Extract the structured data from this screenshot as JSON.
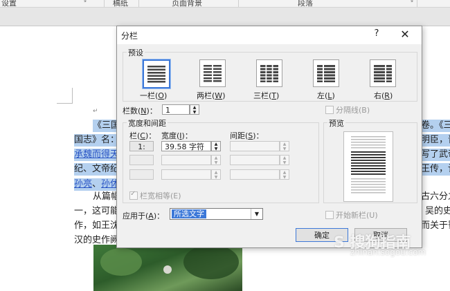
{
  "ribbon": {
    "group_left": "设置",
    "group_manuscript": "稿纸",
    "group_page_bg": "页面背景",
    "group_paragraph": "段落",
    "expander": "↘"
  },
  "document": {
    "para1_line1_left": "《三国",
    "para1_line1_right": "卷。《三",
    "line2_left": "国志》名：",
    "line2_right": "明臣，晋",
    "line3_left": "承魏而得天",
    "line3_right": "写了武帝",
    "line4_left": "纪、文帝纪",
    "line4_right": "王传，记",
    "line5_left_a": "孙亮",
    "line5_sep": "、",
    "line5_left_b": "孙休",
    "line6_left": "从篇幅",
    "line6_right": "古六分之",
    "line7_left": "一，这可能",
    "line7_right": "吴的史",
    "line8_left": "作，如王沈",
    "line8_right": "而关于蜀",
    "line9_left": "汉的史作阙",
    "para_mark": "↵"
  },
  "dialog": {
    "title": "分栏",
    "help": "?",
    "close": "✕",
    "presets_label": "预设",
    "presets": [
      {
        "label": "一栏",
        "key": "O",
        "icon": "one-column-icon"
      },
      {
        "label": "两栏",
        "key": "W",
        "icon": "two-columns-icon"
      },
      {
        "label": "三栏",
        "key": "T",
        "icon": "three-columns-icon"
      },
      {
        "label": "左",
        "key": "L",
        "icon": "left-column-icon"
      },
      {
        "label": "右",
        "key": "R",
        "icon": "right-column-icon"
      }
    ],
    "num_columns_label": "栏数",
    "num_columns_key": "N",
    "num_columns_value": "1",
    "separator_label": "分隔线(B)",
    "width_spacing_label": "宽度和间距",
    "col_label": "栏",
    "col_key": "C",
    "width_label": "宽度",
    "width_key": "I",
    "spacing_label": "间距",
    "spacing_key": "S",
    "row1_col": "1:",
    "row1_width": "39.58 字符",
    "equal_width_label": "栏宽相等(E)",
    "preview_label": "预览",
    "apply_to_label": "应用于",
    "apply_to_key": "A",
    "apply_to_value": "所选文字",
    "new_column_label": "开始新栏(U)",
    "ok_label": "确定",
    "cancel_label": "取消"
  },
  "watermark": {
    "main": "S 搜狗指南",
    "sub": "zhinan.sogou.com"
  }
}
